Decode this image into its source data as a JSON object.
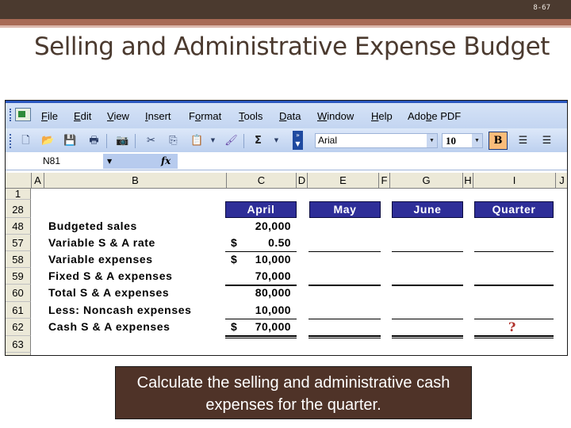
{
  "slide": {
    "number": "8-67",
    "title": "Selling and Administrative Expense Budget",
    "callout": "Calculate the selling and administrative cash expenses for the quarter."
  },
  "colors": {
    "header_band": "#4b3a2f",
    "accent_band": "#a86a55",
    "month_header_bg": "#2e2e98",
    "question_mark": "#b0302a",
    "callout_bg": "#4f3328"
  },
  "excel": {
    "menu": [
      {
        "label": "File",
        "accel": "F",
        "rest": "ile"
      },
      {
        "label": "Edit",
        "accel": "E",
        "rest": "dit"
      },
      {
        "label": "View",
        "accel": "V",
        "rest": "iew"
      },
      {
        "label": "Insert",
        "accel": "I",
        "rest": "nsert"
      },
      {
        "label": "Format",
        "pre": "F",
        "accel": "o",
        "rest": "rmat"
      },
      {
        "label": "Tools",
        "accel": "T",
        "rest": "ools"
      },
      {
        "label": "Data",
        "accel": "D",
        "rest": "ata"
      },
      {
        "label": "Window",
        "accel": "W",
        "rest": "indow"
      },
      {
        "label": "Help",
        "accel": "H",
        "rest": "elp"
      },
      {
        "label": "Adobe PDF",
        "pre": "Ado",
        "accel": "b",
        "rest": "e PDF"
      }
    ],
    "toolbar": {
      "font": "Arial",
      "font_size": "10",
      "bold_label": "B",
      "sum_symbol": "Σ"
    },
    "name_box": "N81",
    "fx_label": "fx",
    "columns": [
      "A",
      "B",
      "C",
      "D",
      "E",
      "F",
      "G",
      "H",
      "I",
      "J"
    ],
    "rows": [
      "1",
      "28",
      "48",
      "57",
      "58",
      "59",
      "60",
      "61",
      "62",
      "63"
    ],
    "month_headers": [
      "April",
      "May",
      "June",
      "Quarter"
    ],
    "line_items": [
      {
        "row": "48",
        "label": "Budgeted sales",
        "april": "20,000",
        "dollar": ""
      },
      {
        "row": "57",
        "label": "Variable S & A rate",
        "april": "0.50",
        "dollar": "$"
      },
      {
        "row": "58",
        "label": "Variable expenses",
        "april": "10,000",
        "dollar": "$"
      },
      {
        "row": "59",
        "label": "Fixed S & A expenses",
        "april": "70,000",
        "dollar": ""
      },
      {
        "row": "60",
        "label": "Total S & A expenses",
        "april": "80,000",
        "dollar": ""
      },
      {
        "row": "61",
        "label": "Less: Noncash expenses",
        "april": "10,000",
        "dollar": ""
      },
      {
        "row": "62",
        "label": "Cash S & A expenses",
        "april": "70,000",
        "dollar": "$"
      }
    ],
    "quarter_answer_placeholder": "?"
  }
}
